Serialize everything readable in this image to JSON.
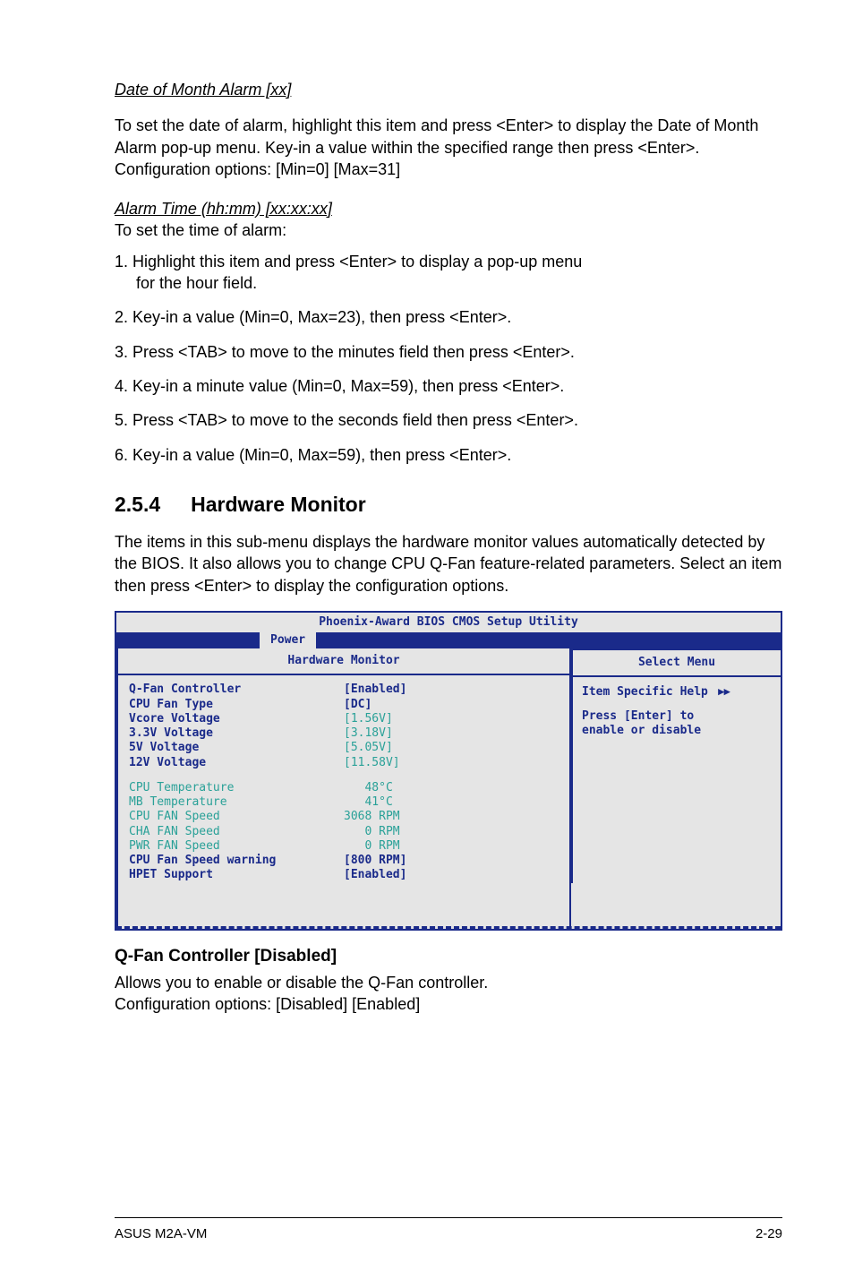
{
  "section1": {
    "h1": "Date of Month Alarm [xx]",
    "p1": "To set the date of alarm, highlight this item and press <Enter> to display the Date of Month Alarm pop-up menu. Key-in a value within the specified range then press <Enter>. Configuration options: [Min=0] [Max=31]",
    "h2": "Alarm Time (hh:mm) [xx:xx:xx]",
    "p2": "To set the time of alarm:",
    "li1a": "1. Highlight this item and press <Enter> to display a pop-up menu",
    "li1b": "for the hour field.",
    "li2": "2. Key-in a value (Min=0, Max=23), then press <Enter>.",
    "li3": "3. Press <TAB> to move to the minutes field then press <Enter>.",
    "li4": "4. Key-in a minute value (Min=0, Max=59), then press <Enter>.",
    "li5": "5. Press <TAB> to move to the seconds field then press <Enter>.",
    "li6": "6. Key-in a value (Min=0, Max=59), then press <Enter>."
  },
  "section2": {
    "num": "2.5.4",
    "title": "Hardware Monitor",
    "p1": "The items in this sub-menu displays the hardware monitor values automatically detected by the BIOS. It also allows you to change CPU Q-Fan feature-related parameters. Select an item then press <Enter> to display the configuration options."
  },
  "bios": {
    "title": "Phoenix-Award BIOS CMOS Setup Utility",
    "tab": "Power",
    "left_title": "Hardware Monitor",
    "right_title": "Select  Menu",
    "help_line1": "Item Specific Help",
    "help_line2": "Press [Enter] to",
    "help_line3": "enable or disable",
    "rows_a": [
      {
        "label": "Q-Fan Controller",
        "value": "[Enabled]",
        "lcls": "blue",
        "vcls": "blue"
      },
      {
        "label": "CPU Fan Type",
        "value": "[DC]",
        "lcls": "blue",
        "vcls": "blue"
      },
      {
        "label": "Vcore Voltage",
        "value": "[1.56V]",
        "lcls": "blue",
        "vcls": "teal"
      },
      {
        "label": "3.3V Voltage",
        "value": "[3.18V]",
        "lcls": "blue",
        "vcls": "teal"
      },
      {
        "label": "5V Voltage",
        "value": "[5.05V]",
        "lcls": "blue",
        "vcls": "teal"
      },
      {
        "label": "12V Voltage",
        "value": "[11.58V]",
        "lcls": "blue",
        "vcls": "teal"
      }
    ],
    "rows_b": [
      {
        "label": "CPU Temperature",
        "value": "   48°C",
        "lcls": "teal",
        "vcls": "teal"
      },
      {
        "label": "MB Temperature",
        "value": "   41°C",
        "lcls": "teal",
        "vcls": "teal"
      },
      {
        "label": "CPU FAN Speed",
        "value": "3068 RPM",
        "lcls": "teal",
        "vcls": "teal"
      },
      {
        "label": "CHA FAN Speed",
        "value": "   0 RPM",
        "lcls": "teal",
        "vcls": "teal"
      },
      {
        "label": "PWR FAN Speed",
        "value": "   0 RPM",
        "lcls": "teal",
        "vcls": "teal"
      },
      {
        "label": "CPU Fan Speed warning",
        "value": "[800 RPM]",
        "lcls": "blue",
        "vcls": "blue"
      },
      {
        "label": "HPET Support",
        "value": "[Enabled]",
        "lcls": "blue",
        "vcls": "blue"
      }
    ]
  },
  "section3": {
    "h": "Q-Fan Controller [Disabled]",
    "p1": "Allows you to enable or disable the Q-Fan controller.",
    "p2": "Configuration options: [Disabled] [Enabled]"
  },
  "footer": {
    "left": "ASUS M2A-VM",
    "right": "2-29"
  }
}
